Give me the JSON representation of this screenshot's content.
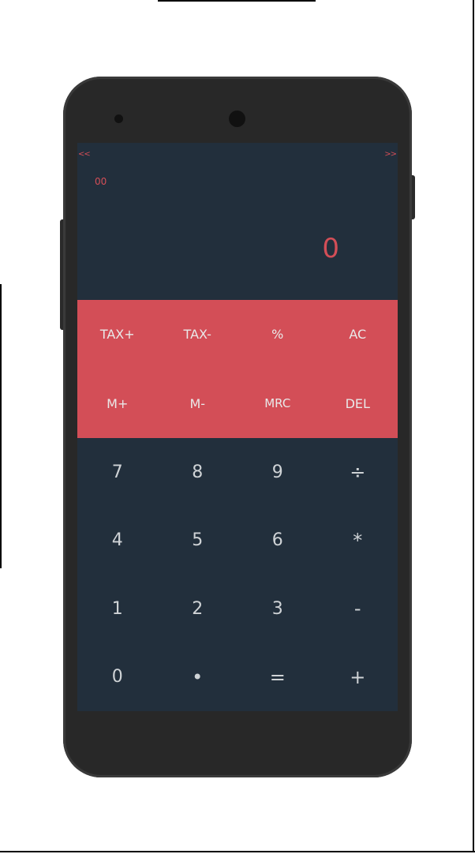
{
  "nav": {
    "prev": "<<",
    "next": ">>"
  },
  "display": {
    "memory": "00",
    "result": "0"
  },
  "function_keys": [
    {
      "label": "TAX+",
      "name": "tax-plus-button"
    },
    {
      "label": "TAX-",
      "name": "tax-minus-button"
    },
    {
      "label": "%",
      "name": "percent-button"
    },
    {
      "label": "AC",
      "name": "all-clear-button"
    },
    {
      "label": "M+",
      "name": "memory-plus-button"
    },
    {
      "label": "M-",
      "name": "memory-minus-button"
    },
    {
      "label": "MRC",
      "name": "memory-recall-clear-button"
    },
    {
      "label": "DEL",
      "name": "delete-button"
    }
  ],
  "number_keys": [
    {
      "label": "7",
      "name": "digit-7-button"
    },
    {
      "label": "8",
      "name": "digit-8-button"
    },
    {
      "label": "9",
      "name": "digit-9-button"
    },
    {
      "label": "÷",
      "name": "divide-button"
    },
    {
      "label": "4",
      "name": "digit-4-button"
    },
    {
      "label": "5",
      "name": "digit-5-button"
    },
    {
      "label": "6",
      "name": "digit-6-button"
    },
    {
      "label": "*",
      "name": "multiply-button"
    },
    {
      "label": "1",
      "name": "digit-1-button"
    },
    {
      "label": "2",
      "name": "digit-2-button"
    },
    {
      "label": "3",
      "name": "digit-3-button"
    },
    {
      "label": "-",
      "name": "subtract-button"
    },
    {
      "label": "0",
      "name": "digit-0-button"
    },
    {
      "label": "•",
      "name": "decimal-point-button"
    },
    {
      "label": "=",
      "name": "equals-button"
    },
    {
      "label": "+",
      "name": "add-button"
    }
  ],
  "colors": {
    "accent": "#d34e57",
    "screen_background": "#222f3c",
    "phone_body": "#2a2a2a",
    "key_text": "#cfd3d6"
  }
}
